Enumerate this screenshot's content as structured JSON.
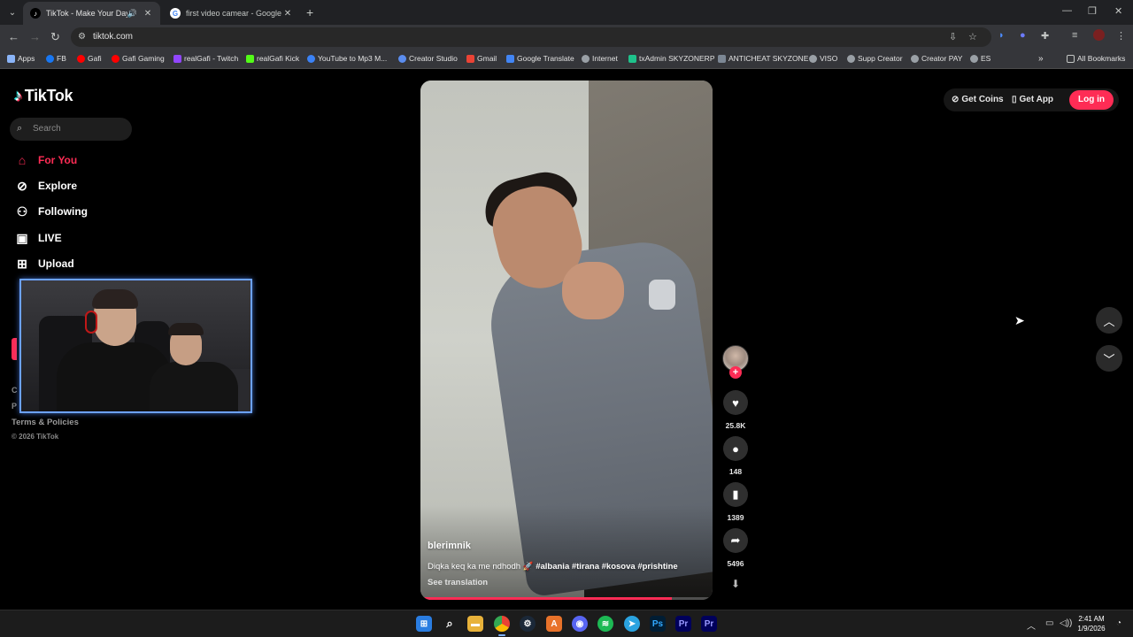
{
  "browser": {
    "tabs": [
      {
        "title": "TikTok - Make Your Day",
        "active": true
      },
      {
        "title": "first video camear - Google Sea",
        "active": false
      }
    ],
    "url": "tiktok.com",
    "bookmarks": [
      {
        "label": "Apps",
        "color": "#8ab4f8"
      },
      {
        "label": "FB",
        "color": "#1877f2"
      },
      {
        "label": "Gafi",
        "color": "#ff0000"
      },
      {
        "label": "Gafi Gaming",
        "color": "#ff0000"
      },
      {
        "label": "realGafi - Twitch",
        "color": "#9146ff"
      },
      {
        "label": "realGafi Kick",
        "color": "#53fc18"
      },
      {
        "label": "YouTube to Mp3 M...",
        "color": "#3b82f6"
      },
      {
        "label": "Creator Studio",
        "color": "#5b8def"
      },
      {
        "label": "Gmail",
        "color": "#ea4335"
      },
      {
        "label": "Google Translate",
        "color": "#4285f4"
      },
      {
        "label": "Internet",
        "color": "#9aa0a6"
      },
      {
        "label": "txAdmin SKYZONERP",
        "color": "#1ec28b"
      },
      {
        "label": "ANTICHEAT SKYZONE",
        "color": "#7c8794"
      },
      {
        "label": "VISO",
        "color": "#9aa0a6"
      },
      {
        "label": "Supp Creator",
        "color": "#9aa0a6"
      },
      {
        "label": "Creator PAY",
        "color": "#9aa0a6"
      },
      {
        "label": "ES",
        "color": "#9aa0a6"
      }
    ],
    "all_bookmarks": "All Bookmarks",
    "overflow": "»"
  },
  "tiktok": {
    "brand": "TikTok",
    "search_placeholder": "Search",
    "nav": [
      {
        "label": "For You",
        "icon": "home-icon",
        "active": true
      },
      {
        "label": "Explore",
        "icon": "compass-icon",
        "active": false
      },
      {
        "label": "Following",
        "icon": "people-icon",
        "active": false
      },
      {
        "label": "LIVE",
        "icon": "live-icon",
        "active": false
      },
      {
        "label": "Upload",
        "icon": "plus-square-icon",
        "active": false
      }
    ],
    "footer_frag_1": "C",
    "footer_frag_2": "P",
    "terms": "Terms & Policies",
    "copyright": "© 2026 TikTok",
    "top_right": {
      "get_coins": "Get Coins",
      "get_app": "Get App",
      "login": "Log in"
    },
    "video": {
      "author": "blerimnik",
      "caption_text": "Diqka keq ka me ndhodh 🚀",
      "hashtags": "#albania #tirana #kosova #prishtine",
      "see_translation": "See translation",
      "progress": 0.86
    },
    "actions": {
      "likes": "25.8K",
      "comments": "148",
      "saves": "1389",
      "shares": "5496"
    }
  },
  "taskbar": {
    "apps": [
      "Windows",
      "Search",
      "File Explorer",
      "Chrome",
      "Steam",
      "Git",
      "Discord",
      "Spotify",
      "Telegram",
      "Ps",
      "Pr",
      "Pr"
    ],
    "time": "2:41 AM",
    "date": "1/9/2026"
  },
  "colors": {
    "accent": "#fe2c55",
    "bg": "#000000",
    "chrome": "#35363a"
  }
}
